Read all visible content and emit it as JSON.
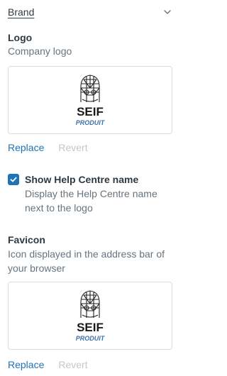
{
  "brand": {
    "section_title": "Brand",
    "logo": {
      "label": "Logo",
      "hint": "Company logo",
      "logo_text_main": "SEIF",
      "logo_text_sub": "PRODUIT",
      "replace_label": "Replace",
      "revert_label": "Revert"
    },
    "help_centre_name": {
      "checked": true,
      "label": "Show Help Centre name",
      "hint": "Display the Help Centre name next to the logo"
    },
    "favicon": {
      "label": "Favicon",
      "hint": "Icon displayed in the address bar of your browser",
      "logo_text_main": "SEIF",
      "logo_text_sub": "PRODUIT",
      "replace_label": "Replace",
      "revert_label": "Revert"
    }
  },
  "colors": {
    "link": "#1f73b7",
    "disabled_link": "#c2c8cc",
    "checkbox": "#1f73b7",
    "logo_sub_text": "#3d6fa8"
  }
}
